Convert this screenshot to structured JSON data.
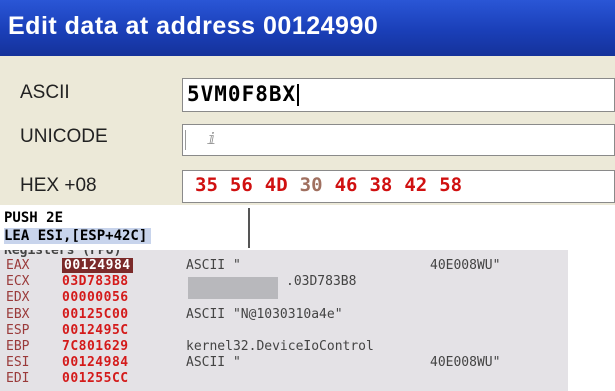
{
  "dialog": {
    "title": "Edit data at address 00124990",
    "ascii_label": "ASCII",
    "ascii_value": "5VM0F8BX",
    "unicode_label": "UNICODE",
    "unicode_value": "ⅈ",
    "hex_label": "HEX +08",
    "hex_bytes": [
      "35",
      "56",
      "4D",
      "30",
      "46",
      "38",
      "42",
      "58"
    ],
    "hex_modified_indices": [
      0,
      1,
      2,
      4,
      5,
      6,
      7
    ]
  },
  "disassembly": {
    "line1": "PUSH 2E",
    "line2": "LEA ESI,[ESP+42C]"
  },
  "registers": {
    "header": "Registers (FPU)",
    "rows": [
      {
        "name": "EAX",
        "value": "00124984",
        "comment": "ASCII \"",
        "extra": "40E008WU\"",
        "highlight": true
      },
      {
        "name": "ECX",
        "value": "03D783B8",
        "comment": "",
        "extra": ".03D783B8",
        "highlight": false
      },
      {
        "name": "EDX",
        "value": "00000056",
        "comment": "",
        "extra": "",
        "highlight": false
      },
      {
        "name": "EBX",
        "value": "00125C00",
        "comment": "ASCII \"N@1030310a4e\"",
        "extra": "",
        "highlight": false
      },
      {
        "name": "ESP",
        "value": "0012495C",
        "comment": "",
        "extra": "",
        "highlight": false
      },
      {
        "name": "EBP",
        "value": "7C801629",
        "comment": "kernel32.DeviceIoControl",
        "extra": "",
        "highlight": false
      },
      {
        "name": "ESI",
        "value": "00124984",
        "comment": "ASCII \"",
        "extra": "40E008WU\"",
        "highlight": false
      },
      {
        "name": "EDI",
        "value": "001255CC",
        "comment": "",
        "extra": "",
        "highlight": false
      }
    ]
  }
}
